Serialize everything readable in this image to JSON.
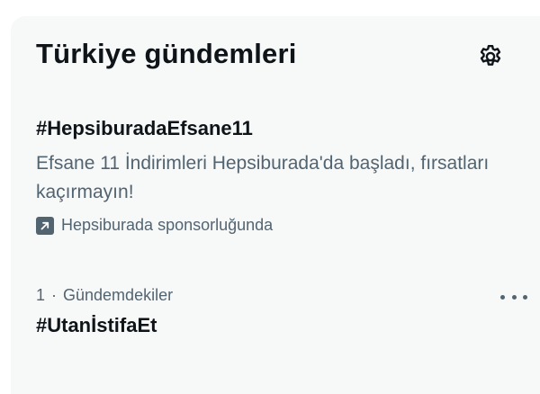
{
  "header": {
    "title": "Türkiye gündemleri",
    "settings_icon": "gear-icon"
  },
  "promoted_trend": {
    "hashtag": "#HepsiburadaEfsane11",
    "description": "Efsane 11 İndirimleri Hepsiburada'da başladı, fırsatları kaçırmayın!",
    "sponsor_icon": "promoted-arrow-icon",
    "sponsor_text": "Hepsiburada sponsorluğunda"
  },
  "trends": [
    {
      "rank": "1",
      "separator": "·",
      "category": "Gündemdekiler",
      "name": "#UtanİstifaEt",
      "more_icon": "more-icon"
    }
  ],
  "colors": {
    "background": "#ffffff",
    "panel": "#f7f9f9",
    "text_primary": "#0f1419",
    "text_secondary": "#536471"
  }
}
